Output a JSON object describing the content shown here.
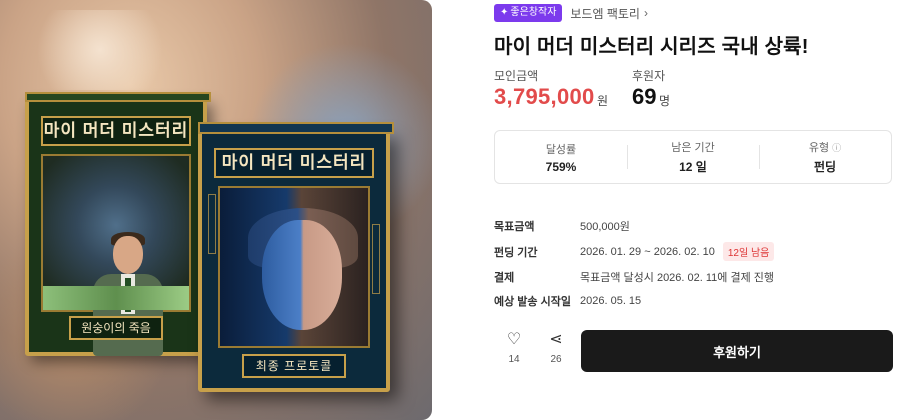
{
  "badge": {
    "label": "좋은창작자"
  },
  "creator": {
    "name": "보드엠 팩토리"
  },
  "project": {
    "title": "마이 머더 미스터리 시리즈 국내 상륙!"
  },
  "hero": {
    "box1": {
      "title": "마이 머더 미스터리",
      "subtitle": "원숭이의 죽음"
    },
    "box2": {
      "title": "마이 머더 미스터리",
      "subtitle": "최종 프로토콜"
    }
  },
  "stats": {
    "raised_label": "모인금액",
    "raised_value": "3,795,000",
    "raised_unit": "원",
    "backers_label": "후원자",
    "backers_value": "69",
    "backers_unit": "명"
  },
  "infobox": [
    {
      "label": "달성률",
      "value": "759%"
    },
    {
      "label": "남은 기간",
      "value": "12 일"
    },
    {
      "label": "유형",
      "value": "펀딩"
    }
  ],
  "details": {
    "goal_label": "목표금액",
    "goal_value": "500,000원",
    "period_label": "펀딩 기간",
    "period_value": "2026. 01. 29 ~ 2026. 02. 10",
    "days_left_badge": "12일 남음",
    "payment_label": "결제",
    "payment_value": "목표금액 달성시 2026. 02. 11에 결제 진행",
    "ship_label": "예상 발송 시작일",
    "ship_value": "2026. 05. 15"
  },
  "actions": {
    "like_count": "14",
    "share_count": "26",
    "support_label": "후원하기"
  },
  "colors": {
    "accent_red": "#e24b4b",
    "badge_purple": "#7c3aed",
    "button_dark": "#1a1a1a"
  }
}
